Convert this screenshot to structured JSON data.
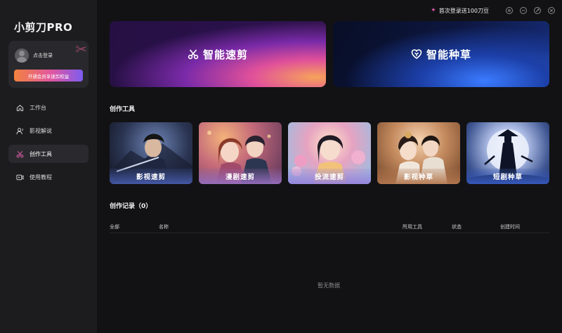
{
  "app": {
    "title": "小剪刀PRO"
  },
  "user": {
    "login_label": "点击登录",
    "vip_button": "开通会员享速剪权益"
  },
  "nav": {
    "items": [
      {
        "label": "工作台",
        "icon": "home-icon"
      },
      {
        "label": "影视解说",
        "icon": "user-voice-icon"
      },
      {
        "label": "创作工具",
        "icon": "scissors-icon",
        "active": true
      },
      {
        "label": "使用教程",
        "icon": "video-tutorial-icon"
      }
    ]
  },
  "topbar": {
    "promo_text": "首次登录送100刀豆"
  },
  "banners": [
    {
      "label": "智能速剪",
      "icon": "scissors-icon"
    },
    {
      "label": "智能种草",
      "icon": "heart-seedling-icon"
    }
  ],
  "tools": {
    "section_title": "创作工具",
    "cards": [
      {
        "label": "影视速剪"
      },
      {
        "label": "漫剧速剪"
      },
      {
        "label": "投流速剪"
      },
      {
        "label": "影视种草"
      },
      {
        "label": "短剧种草"
      }
    ]
  },
  "records": {
    "section_title": "创作记录（0）",
    "columns": [
      "全部",
      "名称",
      "所用工具",
      "状态",
      "创建时间"
    ],
    "empty_text": "暂无数据"
  },
  "colors": {
    "background": "#121214",
    "sidebar": "#1c1c1f",
    "accent_pink": "#e056a2",
    "accent_orange": "#f3823e"
  }
}
